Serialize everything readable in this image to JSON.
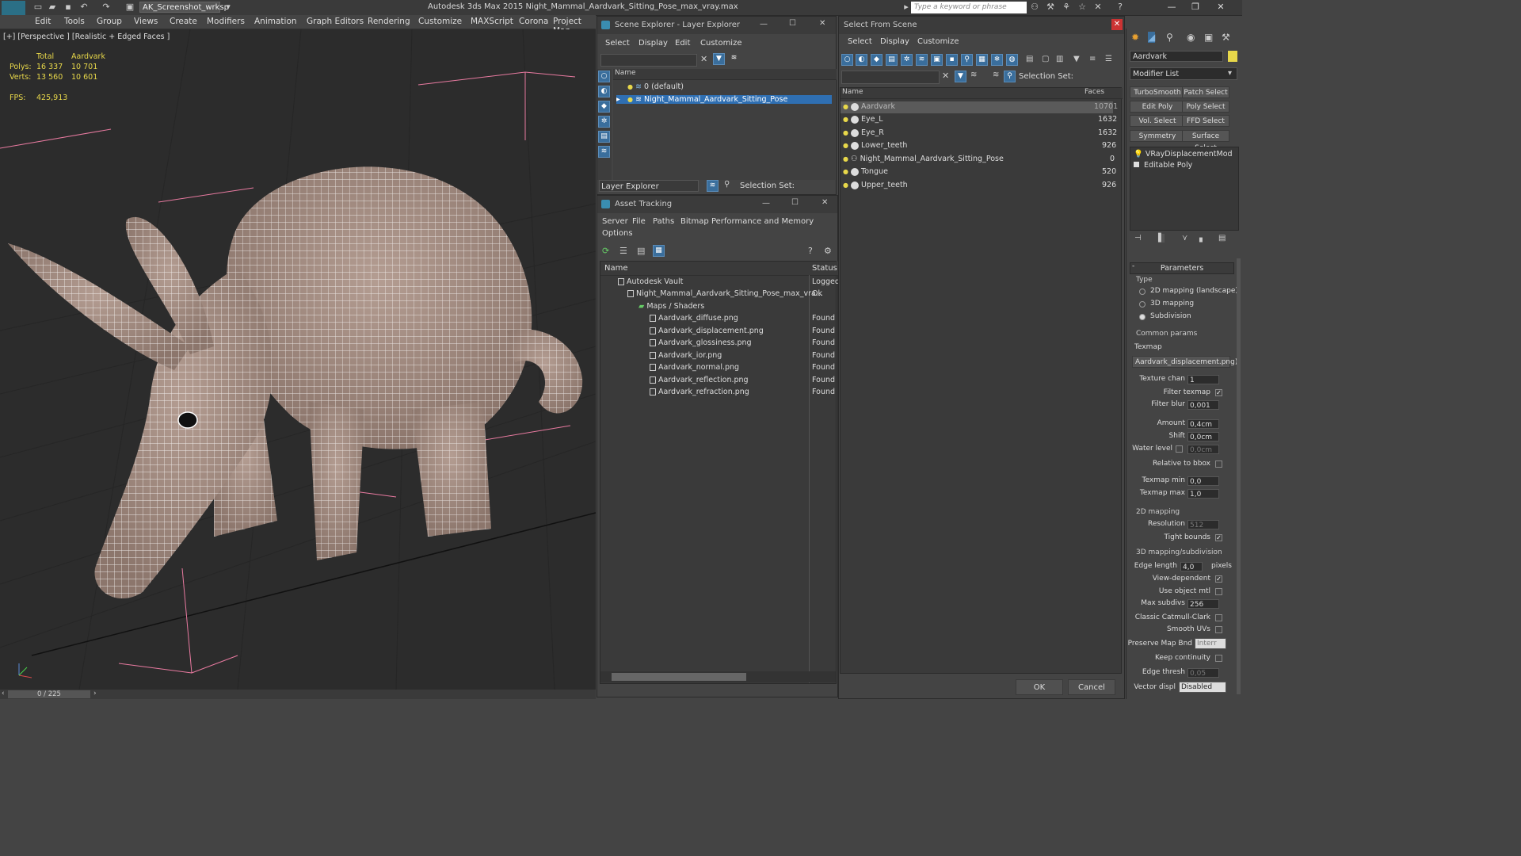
{
  "titlebar": {
    "app_logo": "MAX",
    "workspace": "AK_Screenshot_wrksp",
    "window_title": "Autodesk 3ds Max  2015     Night_Mammal_Aardvark_Sitting_Pose_max_vray.max",
    "search_placeholder": "Type a keyword or phrase"
  },
  "menubar": [
    "Edit",
    "Tools",
    "Group",
    "Views",
    "Create",
    "Modifiers",
    "Animation",
    "Graph Editors",
    "Rendering",
    "Customize",
    "MAXScript",
    "Corona",
    "Project Man"
  ],
  "viewport": {
    "label": "[+] [Perspective ] [Realistic + Edged Faces ]",
    "stats": {
      "total_label": "Total",
      "object_label": "Aardvark",
      "polys_label": "Polys:",
      "polys_total": "16 337",
      "polys_obj": "10 701",
      "verts_label": "Verts:",
      "verts_total": "13 560",
      "verts_obj": "10 601",
      "fps_label": "FPS:",
      "fps": "425,913"
    },
    "timeline": "0 / 225"
  },
  "scene_explorer": {
    "title": "Scene Explorer - Layer Explorer",
    "menus": [
      "Select",
      "Display",
      "Edit",
      "Customize"
    ],
    "col_name": "Name",
    "layers": [
      "0 (default)",
      "Night_Mammal_Aardvark_Sitting_Pose"
    ],
    "footer_combo": "Layer Explorer",
    "selection_set_label": "Selection Set:"
  },
  "asset_tracking": {
    "title": "Asset Tracking",
    "menus": [
      "Server",
      "File",
      "Paths",
      "Bitmap Performance and Memory",
      "Options"
    ],
    "col_name": "Name",
    "col_status": "Status",
    "rows": [
      {
        "name": "Autodesk Vault",
        "status": "Logged"
      },
      {
        "name": "Night_Mammal_Aardvark_Sitting_Pose_max_vra...",
        "status": "Ok"
      },
      {
        "name": "Maps / Shaders",
        "status": ""
      },
      {
        "name": "Aardvark_diffuse.png",
        "status": "Found"
      },
      {
        "name": "Aardvark_displacement.png",
        "status": "Found"
      },
      {
        "name": "Aardvark_glossiness.png",
        "status": "Found"
      },
      {
        "name": "Aardvark_ior.png",
        "status": "Found"
      },
      {
        "name": "Aardvark_normal.png",
        "status": "Found"
      },
      {
        "name": "Aardvark_reflection.png",
        "status": "Found"
      },
      {
        "name": "Aardvark_refraction.png",
        "status": "Found"
      }
    ]
  },
  "select_from_scene": {
    "title": "Select From Scene",
    "menus": [
      "Select",
      "Display",
      "Customize"
    ],
    "selection_set_label": "Selection Set:",
    "col_name": "Name",
    "col_faces": "Faces",
    "objects": [
      {
        "name": "Aardvark",
        "faces": "10701"
      },
      {
        "name": "Eye_L",
        "faces": "1632"
      },
      {
        "name": "Eye_R",
        "faces": "1632"
      },
      {
        "name": "Lower_teeth",
        "faces": "926"
      },
      {
        "name": "Night_Mammal_Aardvark_Sitting_Pose",
        "faces": "0"
      },
      {
        "name": "Tongue",
        "faces": "520"
      },
      {
        "name": "Upper_teeth",
        "faces": "926"
      }
    ],
    "ok": "OK",
    "cancel": "Cancel"
  },
  "command_panel": {
    "object_name": "Aardvark",
    "modifier_list": "Modifier List",
    "mod_buttons": [
      "TurboSmooth",
      "Patch Select",
      "Edit Poly",
      "Poly Select",
      "Vol. Select",
      "FFD Select",
      "Symmetry",
      "Surface Select"
    ],
    "stack": [
      "VRayDisplacementMod",
      "Editable Poly"
    ],
    "params_title": "Parameters",
    "type_label": "Type",
    "type_options": [
      "2D mapping (landscape)",
      "3D mapping",
      "Subdivision"
    ],
    "common_label": "Common params",
    "texmap_label": "Texmap",
    "texmap_value": "Aardvark_displacement.png)",
    "texture_chan_label": "Texture chan",
    "texture_chan": "1",
    "filter_texmap_label": "Filter texmap",
    "filter_blur_label": "Filter blur",
    "filter_blur": "0,001",
    "amount_label": "Amount",
    "amount": "0,4cm",
    "shift_label": "Shift",
    "shift": "0,0cm",
    "water_level_label": "Water level",
    "water_level": "0,0cm",
    "relative_bbox_label": "Relative to bbox",
    "texmap_min_label": "Texmap min",
    "texmap_min": "0,0",
    "texmap_max_label": "Texmap max",
    "texmap_max": "1,0",
    "mapping2d_label": "2D mapping",
    "resolution_label": "Resolution",
    "resolution": "512",
    "tight_bounds_label": "Tight bounds",
    "mapping3d_label": "3D mapping/subdivision",
    "edge_length_label": "Edge length",
    "edge_length": "4,0",
    "pixels_label": "pixels",
    "view_dependent_label": "View-dependent",
    "use_object_mtl_label": "Use object mtl",
    "max_subdivs_label": "Max subdivs",
    "max_subdivs": "256",
    "catmull_label": "Classic Catmull-Clark",
    "smooth_uvs_label": "Smooth UVs",
    "preserve_label": "Preserve Map Bnd",
    "preserve_value": "Interr",
    "keep_continuity_label": "Keep continuity",
    "edge_thresh_label": "Edge thresh",
    "edge_thresh": "0,05",
    "vector_displ_label": "Vector displ",
    "vector_displ": "Disabled"
  },
  "colors": {
    "accent": "#2f6fb2",
    "stat_yellow": "#e8d84a",
    "wire": "#ffffff",
    "skin": "#a89288"
  }
}
